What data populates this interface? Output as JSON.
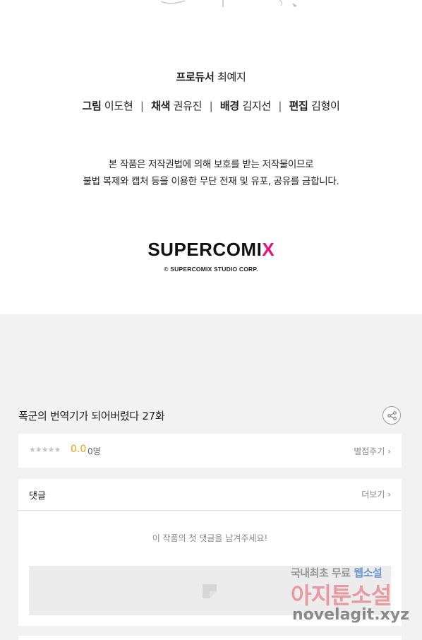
{
  "credits": {
    "producer": {
      "role": "프로듀서",
      "name": "최예지"
    },
    "art": {
      "role": "그림",
      "name": "이도현"
    },
    "color": {
      "role": "채색",
      "name": "권유진"
    },
    "background": {
      "role": "배경",
      "name": "김지선"
    },
    "edit": {
      "role": "편집",
      "name": "김형이"
    },
    "separator": "|"
  },
  "notice": {
    "line1": "본 작품은 저작권법에 의해 보호를 받는 저작물이므로",
    "line2": "불법 복제와 캡처 등을 이용한 무단 전재 및 유포, 공유를 금합니다."
  },
  "publisher": {
    "logo_text": "SUPERCOMI",
    "logo_mark": "X",
    "copyright": "© SUPERCOMIX STUDIO CORP.",
    "accent_color": "#e6147a"
  },
  "episode": {
    "title": "폭군의 번역기가 되어버렸다 27화",
    "share_icon": "share-icon"
  },
  "rating": {
    "stars": "★★★★★",
    "value": "0.0",
    "count": "0명",
    "rate_label": "별점주기 ›",
    "value_color": "#f0a11a"
  },
  "comments": {
    "title": "댓글",
    "more_label": "더보기 ›",
    "empty_message": "이 작품의 첫 댓글을 남겨주세요!"
  },
  "watermark": {
    "line1_a": "국내최초 무료",
    "line1_b": "웹소설",
    "line2": "아지툰소설",
    "line3": "novelagit.xyz"
  }
}
